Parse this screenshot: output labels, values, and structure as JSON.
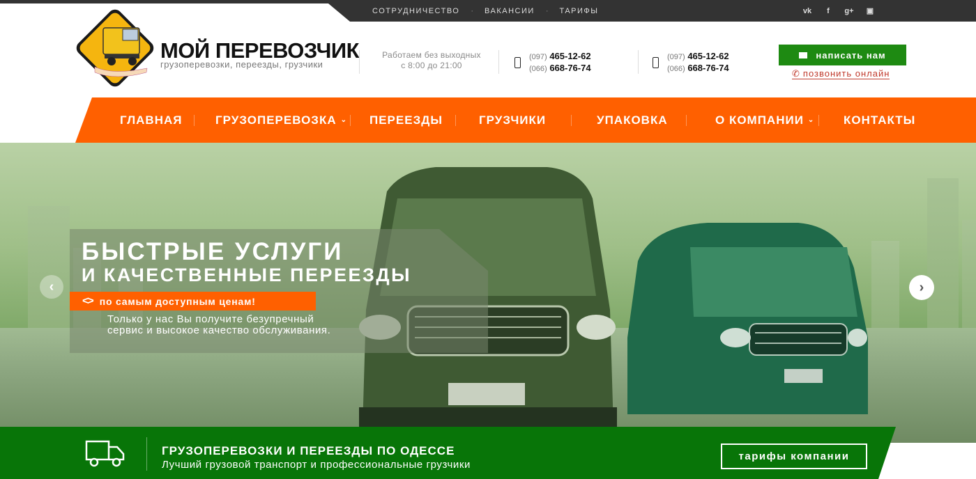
{
  "topbar": {
    "links": [
      "СОТРУДНИЧЕСТВО",
      "ВАКАНСИИ",
      "ТАРИФЫ"
    ],
    "separator": "·",
    "social": [
      "vk",
      "f",
      "g+",
      "▣"
    ]
  },
  "header": {
    "brand_name": "МОЙ ПЕРЕВОЗЧИК",
    "brand_tagline": "грузоперевозки, переезды, грузчики",
    "hours_line1": "Работаем без выходных",
    "hours_line2": "с 8:00 до 21:00",
    "phones": [
      {
        "code1": "(097)",
        "num1": "465-12-62",
        "code2": "(066)",
        "num2": "668-76-74"
      },
      {
        "code1": "(097)",
        "num1": "465-12-62",
        "code2": "(066)",
        "num2": "668-76-74"
      }
    ],
    "write_button": "написать нам",
    "call_link": "позвонить онлайн"
  },
  "nav": {
    "items": [
      "ГЛАВНАЯ",
      "ГРУЗОПЕРЕВОЗКА",
      "ПЕРЕЕЗДЫ",
      "ГРУЗЧИКИ",
      "УПАКОВКА",
      "О КОМПАНИИ",
      "КОНТАКТЫ"
    ],
    "chevron": "⌄"
  },
  "hero": {
    "title_line1": "БЫСТРЫЕ УСЛУГИ",
    "title_line2": "И КАЧЕСТВЕННЫЕ ПЕРЕЕЗДЫ",
    "price_arrows": "<>",
    "price_text": "по самым доступным ценам!",
    "desc_line1": "Только у нас Вы получите безупречный",
    "desc_line2": "сервис и высокое качество обслуживания.",
    "prev": "‹",
    "next": "›"
  },
  "bottom": {
    "title": "ГРУЗОПЕРЕВОЗКИ И ПЕРЕЕЗДЫ ПО ОДЕССЕ",
    "subtitle": "Лучший грузовой транспорт и профессиональные грузчики",
    "button": "тарифы компании"
  },
  "colors": {
    "accent_orange": "#ff6000",
    "accent_green": "#087508",
    "button_green": "#1e8a12",
    "dark": "#333333",
    "call_red": "#c0392b"
  }
}
